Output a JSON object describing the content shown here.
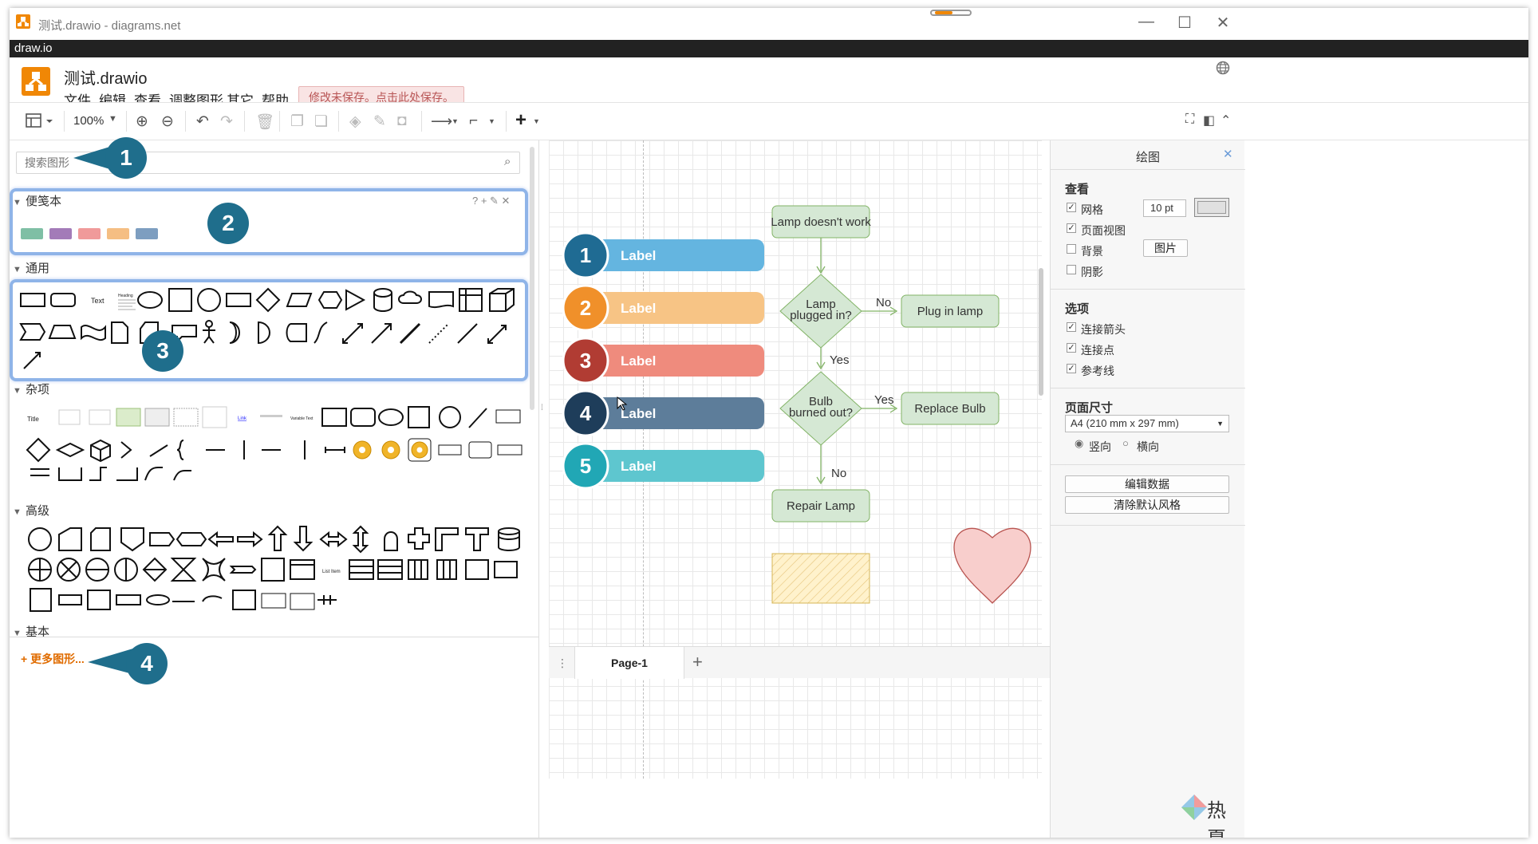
{
  "window": {
    "title": "测试.drawio - diagrams.net",
    "app_name": "draw.io"
  },
  "document": {
    "title": "测试.drawio"
  },
  "menu": [
    "文件",
    "编辑",
    "查看",
    "调整图形",
    "其它",
    "帮助"
  ],
  "unsaved_notice": "修改未保存。点击此处保存。",
  "toolbar": {
    "zoom": "100%"
  },
  "sidebar": {
    "search_placeholder": "搜索图形",
    "sections": [
      "便笺本",
      "通用",
      "杂项",
      "高级",
      "基本"
    ],
    "more_shapes": "+ 更多图形...",
    "general_text_items": [
      "Text",
      "Heading"
    ],
    "misc_text_items": [
      "Title",
      "Link",
      "Variable Text"
    ],
    "advanced_text_items": [
      "List Item"
    ]
  },
  "callouts": [
    "1",
    "2",
    "3",
    "4"
  ],
  "diagram": {
    "numbered_items": [
      {
        "num": "1",
        "label": "Label",
        "circle_color": "#1f6b93",
        "bar_color": "#64b5e0"
      },
      {
        "num": "2",
        "label": "Label",
        "circle_color": "#f0902a",
        "bar_color": "#f7c485"
      },
      {
        "num": "3",
        "label": "Label",
        "circle_color": "#b13c33",
        "bar_color": "#ef8b7d"
      },
      {
        "num": "4",
        "label": "Label",
        "circle_color": "#1e3d5a",
        "bar_color": "#5d7d9a"
      },
      {
        "num": "5",
        "label": "Label",
        "circle_color": "#21a7b5",
        "bar_color": "#5ec6cf"
      }
    ],
    "flowchart": {
      "start": "Lamp doesn't work",
      "decision1": [
        "Lamp",
        "plugged in?"
      ],
      "action1": "Plug in lamp",
      "decision2": [
        "Bulb",
        "burned out?"
      ],
      "action2": "Replace Bulb",
      "end": "Repair Lamp",
      "edge_labels": {
        "no1": "No",
        "yes1": "Yes",
        "yes2": "Yes",
        "no2": "No"
      }
    }
  },
  "pages": {
    "current": "Page-1"
  },
  "format_panel": {
    "title": "绘图",
    "view_heading": "查看",
    "grid_label": "网格",
    "grid_size": "10 pt",
    "page_view_label": "页面视图",
    "background_label": "背景",
    "image_button": "图片",
    "shadow_label": "阴影",
    "options_heading": "选项",
    "connection_arrows": "连接箭头",
    "connection_points": "连接点",
    "guides": "参考线",
    "paper_size_heading": "页面尺寸",
    "paper_size": "A4 (210 mm x 297 mm)",
    "portrait": "竖向",
    "landscape": "横向",
    "edit_data": "编辑数据",
    "clear_default_style": "清除默认风格"
  },
  "watermark": "热夏"
}
